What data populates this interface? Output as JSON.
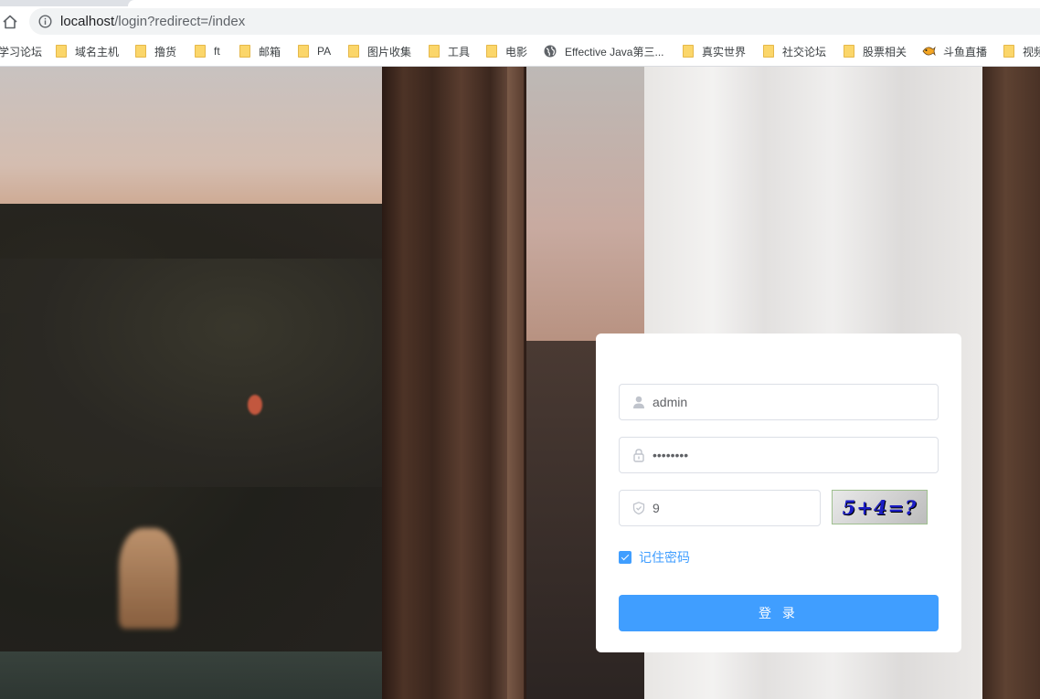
{
  "browser": {
    "url_host": "localhost",
    "url_path": "/login?redirect=/index",
    "bookmarks": [
      {
        "label": "学习论坛",
        "icon": "none"
      },
      {
        "label": "域名主机",
        "icon": "folder-icon"
      },
      {
        "label": "撸货",
        "icon": "folder-icon"
      },
      {
        "label": "ft",
        "icon": "folder-icon"
      },
      {
        "label": "邮箱",
        "icon": "folder-icon"
      },
      {
        "label": "PA",
        "icon": "folder-icon"
      },
      {
        "label": "图片收集",
        "icon": "folder-icon"
      },
      {
        "label": "工具",
        "icon": "folder-icon"
      },
      {
        "label": "电影",
        "icon": "folder-icon"
      },
      {
        "label": "Effective Java第三...",
        "icon": "globe-icon"
      },
      {
        "label": "真实世界",
        "icon": "folder-icon"
      },
      {
        "label": "社交论坛",
        "icon": "folder-icon"
      },
      {
        "label": "股票相关",
        "icon": "folder-icon"
      },
      {
        "label": "斗鱼直播",
        "icon": "fish-icon"
      },
      {
        "label": "视频",
        "icon": "folder-icon"
      }
    ]
  },
  "login": {
    "username": "admin",
    "password": "admin123",
    "code": "9",
    "captcha_text": "5+4=?",
    "remember_label": "记住密码",
    "remember_checked": true,
    "submit_label": "登 录"
  },
  "colors": {
    "primary": "#409eff",
    "input_border": "#dcdfe6",
    "placeholder_icon": "#c0c4cc"
  }
}
